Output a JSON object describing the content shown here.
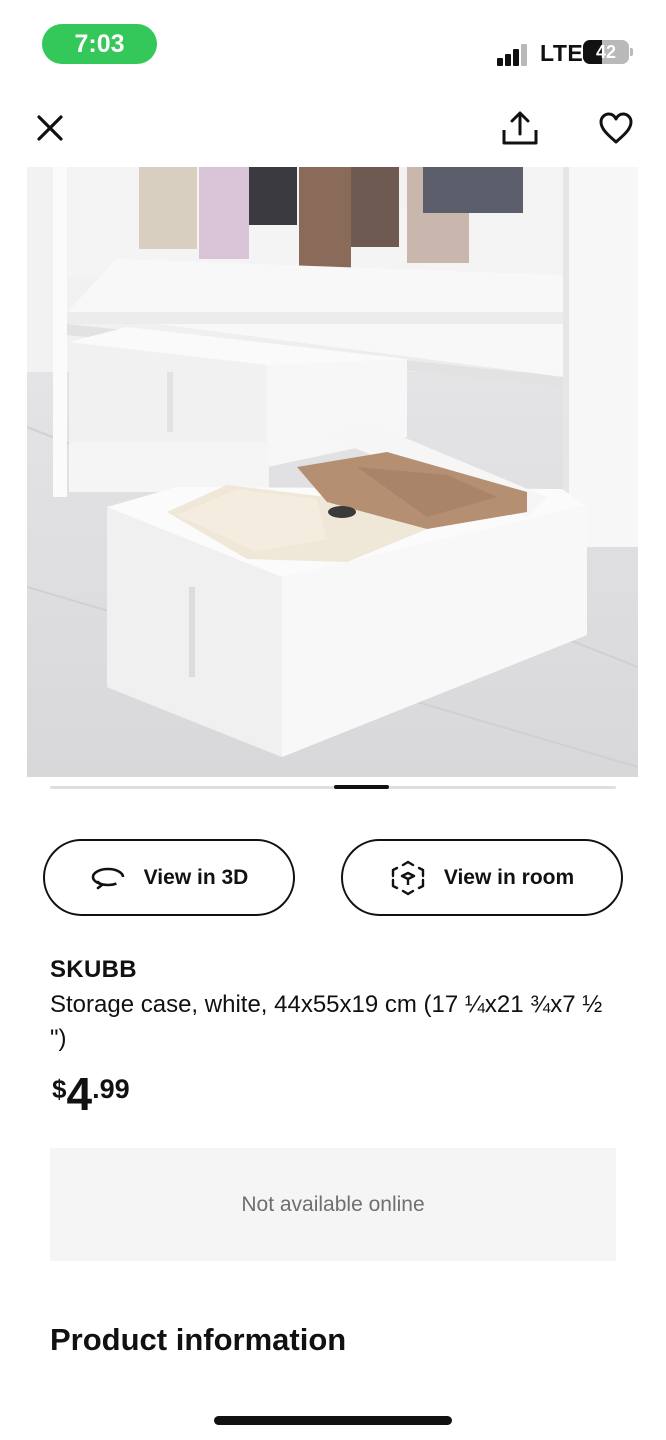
{
  "status_bar": {
    "time": "7:03",
    "network": "LTE",
    "battery": "42",
    "battery_level": 0.42,
    "time_pill_color": "#34c759"
  },
  "nav": {
    "close_icon": "close-icon",
    "share_icon": "share-icon",
    "favorite_icon": "heart-icon"
  },
  "gallery": {
    "image_subject": "storage-case-photo",
    "current_index": 7
  },
  "actions": {
    "view_3d_label": "View in 3D",
    "view_3d_icon": "rotate-3d-icon",
    "view_room_label": "View in room",
    "view_room_icon": "ar-cube-icon"
  },
  "product": {
    "name": "SKUBB",
    "description": "Storage case, white, 44x55x19 cm (17 ¼x21 ¾x7 ½ \")",
    "price": {
      "currency": "$",
      "whole": "4",
      "decimal": ".99"
    },
    "availability": "Not available online"
  },
  "sections": {
    "product_information": "Product information"
  },
  "colors": {
    "text": "#111111",
    "muted": "#6f6f6f",
    "panel": "#f5f5f5"
  }
}
